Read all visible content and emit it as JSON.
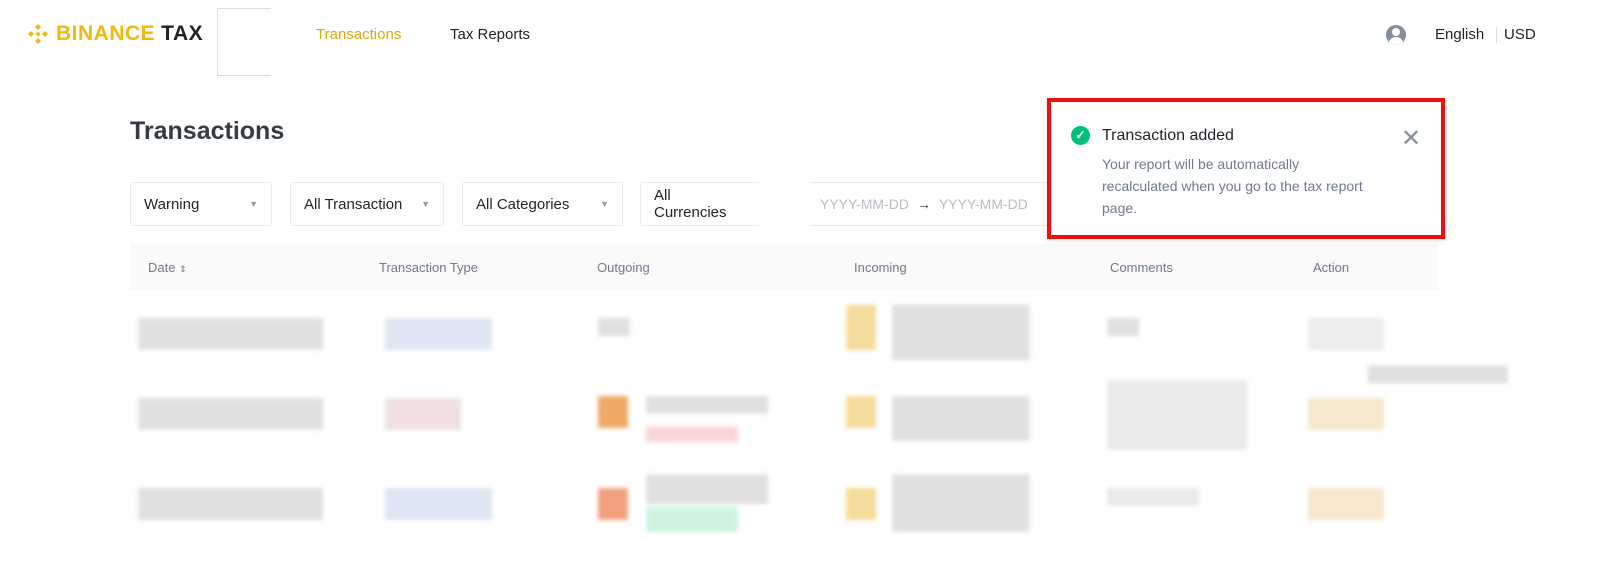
{
  "header": {
    "logo_brand": "BINANCE",
    "logo_product": "TAX",
    "nav": [
      {
        "label": "Transactions",
        "active": true
      },
      {
        "label": "Tax Reports",
        "active": false
      }
    ],
    "language": "English",
    "currency": "USD"
  },
  "page": {
    "title": "Transactions"
  },
  "filters": {
    "status": "Warning",
    "type": "All Transaction",
    "category": "All Categories",
    "currency": "All Currencies",
    "date_start_placeholder": "YYYY-MM-DD",
    "date_end_placeholder": "YYYY-MM-DD"
  },
  "table": {
    "columns": [
      "Date",
      "Transaction Type",
      "Outgoing",
      "Incoming",
      "Comments",
      "Action"
    ]
  },
  "toast": {
    "title": "Transaction added",
    "message": "Your report will be automatically recalculated when you go to the tax report page.",
    "highlight_color": "#f00d0d",
    "success_color": "#02c076"
  },
  "colors": {
    "accent": "#f0b90b"
  }
}
